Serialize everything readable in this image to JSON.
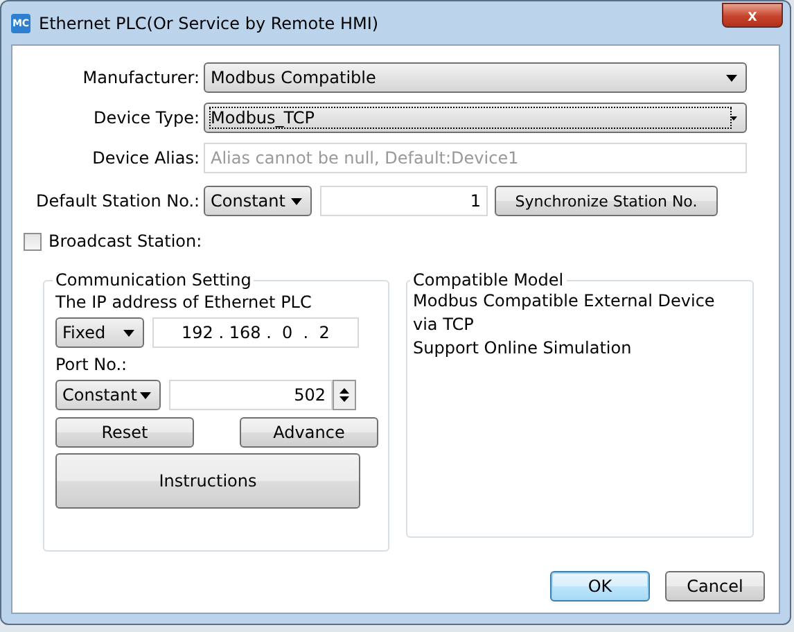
{
  "window": {
    "title": "Ethernet PLC(Or Service by Remote HMI)",
    "app_badge": "MC",
    "close": "x"
  },
  "manufacturer": {
    "label": "Manufacturer:",
    "value": "Modbus Compatible"
  },
  "device_type": {
    "label": "Device Type:",
    "value": "Modbus_TCP",
    "focused": true
  },
  "device_alias": {
    "label": "Device Alias:",
    "placeholder": "Alias cannot be null, Default:Device1"
  },
  "station": {
    "label": "Default Station No.:",
    "mode": "Constant",
    "value": "1",
    "button": "Synchronize Station No."
  },
  "broadcast": {
    "label": "Broadcast Station:",
    "checked": false
  },
  "communication": {
    "title": "Communication Setting",
    "ip_label": "The IP address of Ethernet PLC",
    "ip_mode": "Fixed",
    "ip_address": "192 . 168 .  0  .  2",
    "port_label": "Port No.:",
    "port_mode": "Constant",
    "port": "502",
    "reset": "Reset",
    "advance": "Advance",
    "instructions": "Instructions"
  },
  "compatible_model": {
    "title": "Compatible Model",
    "lines": [
      "Modbus Compatible External Device",
      "via TCP",
      "Support Online Simulation"
    ]
  },
  "buttons": [
    {
      "label": "OK",
      "default": true
    },
    {
      "label": "Cancel",
      "default": false
    }
  ]
}
